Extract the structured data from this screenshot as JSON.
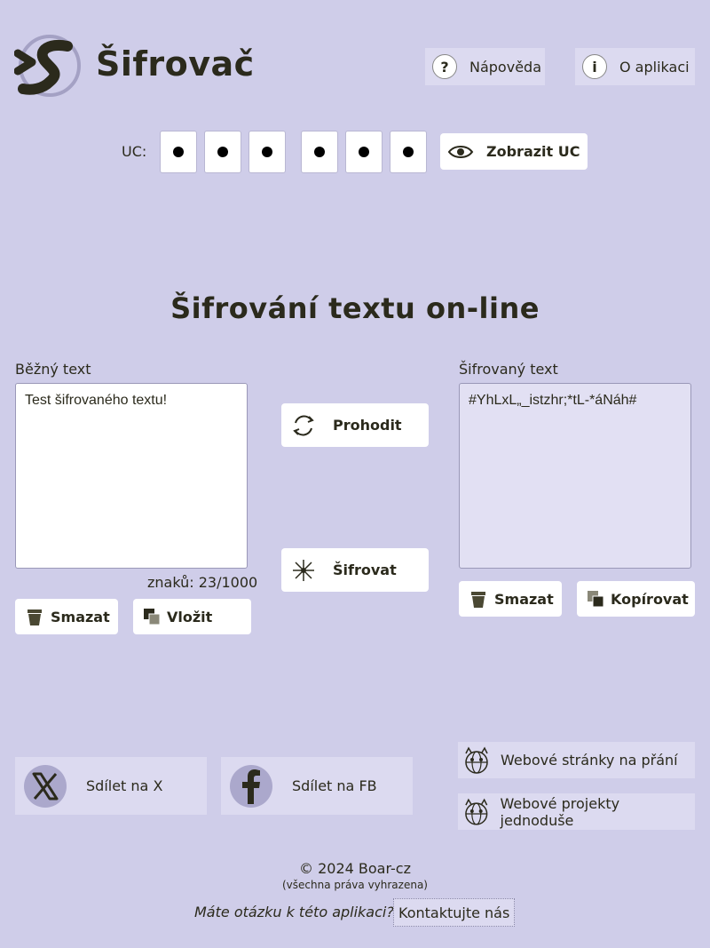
{
  "header": {
    "app_title": "Šifrovač",
    "help_label": "Nápověda",
    "about_label": "O aplikaci"
  },
  "uc": {
    "label": "UC:",
    "dots": [
      "•",
      "•",
      "•",
      "•",
      "•",
      "•"
    ],
    "show_label": "Zobrazit UC"
  },
  "main": {
    "heading": "Šifrování textu on-line",
    "plain": {
      "label": "Běžný text",
      "value": "Test šifrovaného textu!",
      "counter": "znaků: 23/1000",
      "clear_label": "Smazat",
      "paste_label": "Vložit"
    },
    "cipher": {
      "label": "Šifrovaný text",
      "value": "#YhLxL„_istzhr;*tL-*áNáh#",
      "clear_label": "Smazat",
      "copy_label": "Kopírovat"
    },
    "swap_label": "Prohodit",
    "encrypt_label": "Šifrovat"
  },
  "share": {
    "x_label": "Sdílet na X",
    "fb_label": "Sdílet na FB"
  },
  "links": {
    "web_custom": "Webové stránky na přání",
    "web_simple": "Webové projekty jednoduše"
  },
  "footer": {
    "copyright": "© 2024 Boar-cz",
    "rights": "(všechna práva vyhrazena)",
    "question": "Máte otázku k této aplikaci?",
    "contact": "Kontaktujte nás"
  },
  "colors": {
    "background": "#cfcde9",
    "panel": "#dcdaf0",
    "text": "#2b2a1c"
  }
}
